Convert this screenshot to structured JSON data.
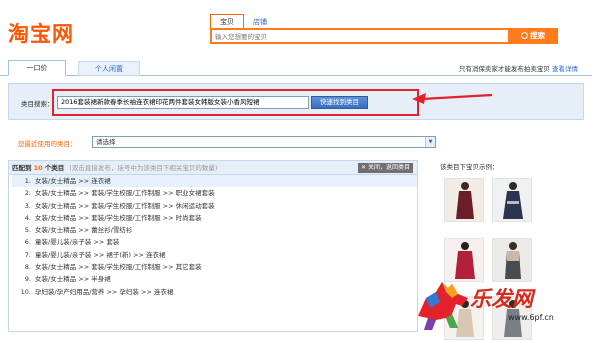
{
  "brand": {
    "logo_text": "淘宝网"
  },
  "search": {
    "tabs": [
      "宝贝",
      "店铺"
    ],
    "placeholder": "输入您想要的宝贝",
    "button_label": "搜索"
  },
  "page_tabs": {
    "tab_one": "一口价",
    "tab_two": "个人闲置",
    "note_text": "只有消保卖家才能发布拍卖宝贝",
    "note_link": "查看详情"
  },
  "category_search": {
    "label": "类目搜索：",
    "value": "2016套装裙新款春季长袖连衣裙印花两件套装女韩版女装小香风短裙",
    "button_label": "快速找到类目"
  },
  "recent": {
    "label": "您最近使用的类目：",
    "selected": "请选择"
  },
  "results": {
    "count_prefix": "匹配到",
    "count": "10",
    "count_suffix": "个类目",
    "hint": "(双击直接发布，括号中为该类目下相关宝贝的数量)",
    "close_label": "关闭，返回类目",
    "items": [
      {
        "num": "1.",
        "path": "女装/女士精品 >> 连衣裙"
      },
      {
        "num": "2.",
        "path": "女装/女士精品 >> 套装/学生校服/工作制服 >> 职业女裙套装"
      },
      {
        "num": "3.",
        "path": "女装/女士精品 >> 套装/学生校服/工作制服 >> 休闲运动套装"
      },
      {
        "num": "4.",
        "path": "女装/女士精品 >> 套装/学生校服/工作制服 >> 时尚套装"
      },
      {
        "num": "5.",
        "path": "女装/女士精品 >> 蕾丝衫/雪纺衫"
      },
      {
        "num": "6.",
        "path": "童装/婴儿装/亲子装 >> 套装"
      },
      {
        "num": "7.",
        "path": "童装/婴儿装/亲子装 >> 裙子(新) >> 连衣裙"
      },
      {
        "num": "8.",
        "path": "女装/女士精品 >> 套装/学生校服/工作制服 >> 其它套装"
      },
      {
        "num": "9.",
        "path": "女装/女士精品 >> 半身裙"
      },
      {
        "num": "10.",
        "path": "孕妇装/孕产妇用品/营养 >> 孕妇装 >> 连衣裙"
      }
    ]
  },
  "examples": {
    "title": "该类目下宝贝示例："
  },
  "watermark": {
    "text": "乐发网",
    "url": "www.6pf.cn"
  },
  "colors": {
    "accent": "#ff5500",
    "highlight_border": "#e4222b",
    "link": "#3366cc",
    "panel": "#e6eff8"
  },
  "icons": {
    "search": "magnifier-icon",
    "arrow": "red-arrow-icon",
    "close": "x-icon"
  }
}
